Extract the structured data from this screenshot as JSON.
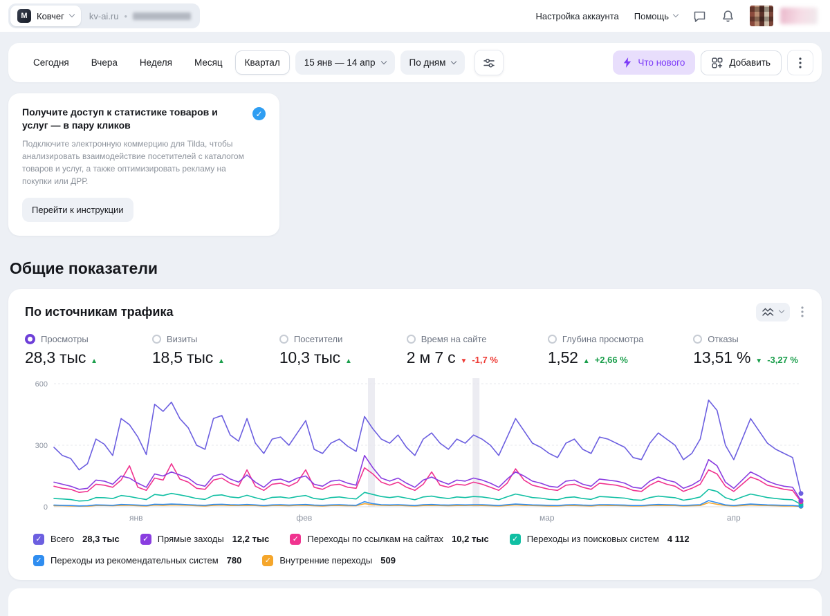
{
  "icons": {
    "check": "✓",
    "dot_separator": "•"
  },
  "topbar": {
    "counter_name": "Ковчег",
    "counter_domain": "kv-ai.ru",
    "account_settings": "Настройка аккаунта",
    "help": "Помощь"
  },
  "toolbar": {
    "periods": [
      "Сегодня",
      "Вчера",
      "Неделя",
      "Месяц",
      "Квартал"
    ],
    "active_period": "Квартал",
    "date_range": "15 янв — 14 апр",
    "granularity": "По дням",
    "whats_new": "Что нового",
    "add": "Добавить"
  },
  "promo": {
    "title": "Получите доступ к статистике товаров и услуг — в пару кликов",
    "body": "Подключите электронную коммерцию для Tilda, чтобы анализировать взаимодействие посетителей с каталогом товаров и услуг, а также оптимизировать рекламу на покупки или ДРР.",
    "cta": "Перейти к инструкции"
  },
  "section_title": "Общие показатели",
  "widget": {
    "title": "По источникам трафика",
    "metrics": [
      {
        "label": "Просмотры",
        "value": "28,3 тыс",
        "arrow": "▲",
        "color": "#1a9e4b",
        "delta": "",
        "selected": true
      },
      {
        "label": "Визиты",
        "value": "18,5 тыс",
        "arrow": "▲",
        "color": "#1a9e4b",
        "delta": ""
      },
      {
        "label": "Посетители",
        "value": "10,3 тыс",
        "arrow": "▲",
        "color": "#1a9e4b",
        "delta": ""
      },
      {
        "label": "Время на сайте",
        "value": "2 м 7 с",
        "arrow": "▼",
        "color": "#ee3b35",
        "delta": "-1,7 %"
      },
      {
        "label": "Глубина просмотра",
        "value": "1,52",
        "arrow": "▲",
        "color": "#1a9e4b",
        "delta": "+2,66 %"
      },
      {
        "label": "Отказы",
        "value": "13,51 %",
        "arrow": "▼",
        "color": "#1a9e4b",
        "delta": "-3,27 %"
      }
    ],
    "legend": [
      {
        "label": "Всего",
        "value": "28,3 тыс",
        "color": "#6c5fe0"
      },
      {
        "label": "Прямые заходы",
        "value": "12,2 тыс",
        "color": "#8a3de0"
      },
      {
        "label": "Переходы по ссылкам на сайтах",
        "value": "10,2 тыс",
        "color": "#f0338f"
      },
      {
        "label": "Переходы из поисковых систем",
        "value": "4 112",
        "color": "#10bfa3"
      },
      {
        "label": "Переходы из рекомендательных систем",
        "value": "780",
        "color": "#2f8df0"
      },
      {
        "label": "Внутренние переходы",
        "value": "509",
        "color": "#f5a62b"
      }
    ]
  },
  "chart_data": {
    "type": "line",
    "title": "По источникам трафика",
    "x_unit": "дни, 15 янв — 14 апр",
    "ylim": [
      0,
      600
    ],
    "yticks": [
      0,
      300,
      600
    ],
    "xticks": [
      {
        "label": "янв",
        "pos": 0.11
      },
      {
        "label": "фев",
        "pos": 0.335
      },
      {
        "label": "мар",
        "pos": 0.66
      },
      {
        "label": "апр",
        "pos": 0.91
      }
    ],
    "highlight_bands": [
      0.425,
      0.565
    ],
    "series": [
      {
        "name": "Всего",
        "color": "#6c5fe0",
        "values": [
          290,
          250,
          235,
          180,
          210,
          330,
          305,
          250,
          430,
          400,
          340,
          255,
          500,
          465,
          510,
          430,
          385,
          300,
          280,
          430,
          445,
          350,
          320,
          430,
          310,
          260,
          330,
          340,
          300,
          360,
          420,
          280,
          260,
          310,
          330,
          295,
          270,
          440,
          380,
          330,
          310,
          350,
          290,
          250,
          330,
          360,
          310,
          280,
          330,
          310,
          350,
          330,
          300,
          250,
          340,
          430,
          370,
          310,
          290,
          260,
          240,
          310,
          330,
          280,
          260,
          340,
          330,
          310,
          290,
          240,
          230,
          310,
          360,
          330,
          300,
          230,
          260,
          330,
          520,
          470,
          300,
          230,
          330,
          430,
          370,
          310,
          280,
          260,
          240,
          65
        ]
      },
      {
        "name": "Прямые заходы",
        "color": "#8a3de0",
        "values": [
          120,
          110,
          100,
          85,
          90,
          130,
          125,
          110,
          150,
          140,
          115,
          95,
          160,
          150,
          170,
          155,
          140,
          110,
          100,
          150,
          160,
          135,
          120,
          155,
          120,
          95,
          130,
          135,
          120,
          140,
          150,
          110,
          100,
          125,
          130,
          115,
          105,
          250,
          190,
          140,
          125,
          140,
          115,
          95,
          130,
          145,
          125,
          110,
          130,
          125,
          140,
          130,
          115,
          95,
          135,
          170,
          150,
          125,
          115,
          100,
          95,
          125,
          130,
          110,
          100,
          135,
          130,
          125,
          115,
          95,
          90,
          125,
          145,
          130,
          120,
          90,
          105,
          130,
          230,
          200,
          120,
          90,
          130,
          170,
          150,
          125,
          110,
          100,
          95,
          30
        ]
      },
      {
        "name": "Переходы по ссылкам на сайтах",
        "color": "#f0338f",
        "values": [
          100,
          90,
          85,
          70,
          75,
          110,
          105,
          95,
          130,
          200,
          95,
          80,
          140,
          130,
          210,
          135,
          120,
          90,
          85,
          130,
          140,
          115,
          100,
          180,
          100,
          80,
          110,
          115,
          100,
          120,
          180,
          95,
          85,
          105,
          110,
          95,
          90,
          190,
          160,
          120,
          105,
          120,
          95,
          80,
          110,
          170,
          105,
          95,
          110,
          105,
          120,
          110,
          95,
          80,
          115,
          185,
          130,
          105,
          95,
          85,
          80,
          105,
          110,
          95,
          85,
          115,
          110,
          105,
          95,
          80,
          75,
          105,
          125,
          110,
          100,
          75,
          90,
          110,
          180,
          160,
          100,
          75,
          110,
          145,
          130,
          105,
          95,
          85,
          80,
          25
        ]
      },
      {
        "name": "Переходы из поисковых систем",
        "color": "#10bfa3",
        "values": [
          40,
          38,
          35,
          28,
          30,
          45,
          44,
          40,
          55,
          50,
          42,
          35,
          60,
          55,
          65,
          58,
          50,
          40,
          36,
          55,
          58,
          48,
          44,
          56,
          44,
          34,
          46,
          48,
          42,
          50,
          55,
          40,
          36,
          45,
          48,
          42,
          38,
          70,
          60,
          50,
          45,
          50,
          42,
          34,
          48,
          52,
          45,
          40,
          48,
          45,
          50,
          48,
          42,
          34,
          49,
          62,
          54,
          45,
          42,
          36,
          34,
          45,
          48,
          40,
          36,
          50,
          48,
          45,
          42,
          34,
          32,
          45,
          52,
          48,
          44,
          32,
          38,
          48,
          85,
          75,
          44,
          32,
          48,
          62,
          54,
          45,
          40,
          36,
          34,
          12
        ]
      },
      {
        "name": "Переходы из рекомендательных систем",
        "color": "#2f8df0",
        "values": [
          8,
          7,
          6,
          4,
          5,
          9,
          8,
          7,
          11,
          10,
          8,
          6,
          12,
          11,
          13,
          12,
          10,
          8,
          7,
          11,
          12,
          10,
          9,
          11,
          9,
          6,
          9,
          10,
          8,
          10,
          11,
          8,
          7,
          9,
          10,
          8,
          7,
          25,
          15,
          10,
          9,
          10,
          8,
          6,
          10,
          11,
          9,
          8,
          10,
          9,
          10,
          10,
          8,
          6,
          10,
          13,
          11,
          9,
          8,
          7,
          6,
          9,
          10,
          8,
          7,
          10,
          10,
          9,
          8,
          6,
          6,
          9,
          11,
          10,
          9,
          6,
          8,
          10,
          30,
          20,
          9,
          6,
          10,
          13,
          11,
          9,
          8,
          7,
          6,
          3
        ]
      },
      {
        "name": "Внутренние переходы",
        "color": "#f5a62b",
        "values": [
          5,
          5,
          4,
          3,
          3,
          6,
          6,
          5,
          7,
          7,
          5,
          4,
          8,
          7,
          9,
          8,
          7,
          5,
          4,
          7,
          8,
          6,
          6,
          7,
          6,
          4,
          6,
          6,
          5,
          7,
          7,
          5,
          4,
          6,
          6,
          5,
          5,
          15,
          10,
          7,
          6,
          7,
          5,
          4,
          6,
          7,
          6,
          5,
          6,
          6,
          7,
          6,
          5,
          4,
          6,
          9,
          7,
          6,
          5,
          4,
          4,
          6,
          6,
          5,
          4,
          7,
          6,
          6,
          5,
          4,
          4,
          6,
          7,
          6,
          6,
          4,
          5,
          6,
          20,
          12,
          6,
          4,
          6,
          9,
          7,
          6,
          5,
          4,
          4,
          2
        ]
      }
    ]
  }
}
